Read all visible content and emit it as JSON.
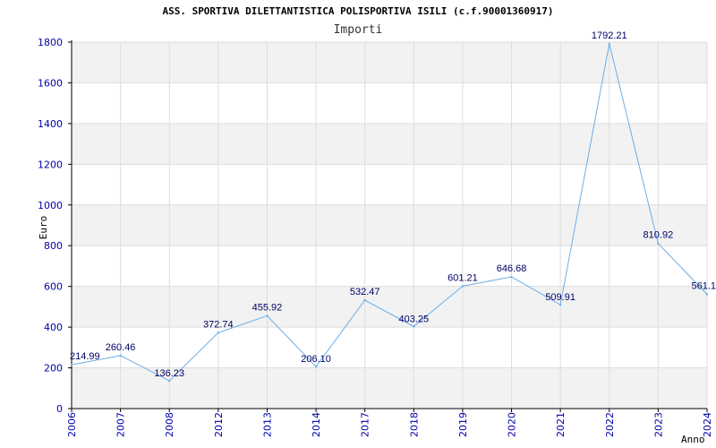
{
  "chart_data": {
    "type": "line",
    "title": "ASS. SPORTIVA DILETTANTISTICA POLISPORTIVA ISILI (c.f.90001360917)",
    "subtitle": "Importi",
    "xlabel": "Anno",
    "ylabel": "Euro",
    "categories": [
      "2006",
      "2007",
      "2008",
      "2012",
      "2013",
      "2014",
      "2017",
      "2018",
      "2019",
      "2020",
      "2021",
      "2022",
      "2023",
      "2024"
    ],
    "series": [
      {
        "values": [
          214.99,
          260.46,
          136.23,
          372.74,
          455.92,
          206.1,
          532.47,
          403.25,
          601.21,
          646.68,
          509.91,
          1792.21,
          810.92,
          561.1
        ]
      }
    ],
    "data_labels": [
      "214.99",
      "260.46",
      "136.23",
      "372.74",
      "455.92",
      "206.10",
      "532.47",
      "403.25",
      "601.21",
      "646.68",
      "509.91",
      "1792.21",
      "810.92",
      "561.1"
    ],
    "y_ticks": [
      "0",
      "200",
      "400",
      "600",
      "800",
      "1000",
      "1200",
      "1400",
      "1600",
      "1800"
    ],
    "ylim": [
      0,
      1800
    ],
    "grid": true,
    "colors": {
      "line": "#6aaee8",
      "band": "#f2f2f2",
      "gridline": "#dddddd",
      "axis": "#000000",
      "tick_text": "#0000aa",
      "label_text": "#000066"
    }
  }
}
